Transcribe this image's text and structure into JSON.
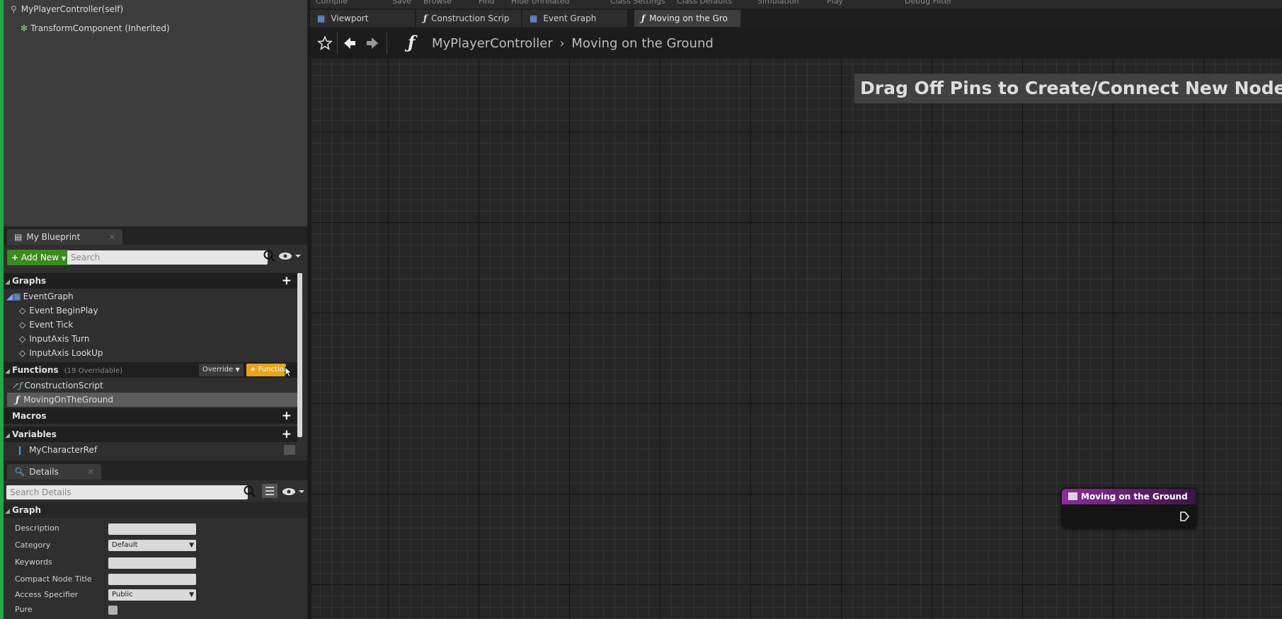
{
  "components": {
    "self_label": "MyPlayerController(self)",
    "child_label": "TransformComponent (Inherited)"
  },
  "my_blueprint": {
    "tab_label": "My Blueprint",
    "add_new_label": "Add New",
    "search_placeholder": "Search",
    "graphs": {
      "header": "Graphs",
      "event_graph": "EventGraph",
      "events": [
        "Event BeginPlay",
        "Event Tick",
        "InputAxis Turn",
        "InputAxis LookUp"
      ]
    },
    "functions": {
      "header": "Functions",
      "overridable": "(19 Overridable)",
      "override_label": "Override",
      "add_function_label": "Function",
      "items": [
        "ConstructionScript",
        "MovingOnTheGround"
      ]
    },
    "macros": {
      "header": "Macros"
    },
    "variables": {
      "header": "Variables",
      "items": [
        "MyCharacterRef"
      ]
    }
  },
  "details": {
    "tab_label": "Details",
    "search_placeholder": "Search Details",
    "section": "Graph",
    "props": {
      "description": "Description",
      "category": "Category",
      "category_value": "Default",
      "keywords": "Keywords",
      "compact_title": "Compact Node Title",
      "access": "Access Specifier",
      "access_value": "Public",
      "pure": "Pure"
    }
  },
  "toolbar": [
    "Compile",
    "Save",
    "Browse",
    "Find",
    "Hide Unrelated",
    "Class Settings",
    "Class Defaults",
    "Simulation",
    "Play",
    "Debug Filter"
  ],
  "doc_tabs": [
    "Viewport",
    "Construction Scrip",
    "Event Graph",
    "Moving on the Gro"
  ],
  "breadcrumb": {
    "root": "MyPlayerController",
    "current": "Moving on the Ground"
  },
  "graph": {
    "hint": "Drag Off Pins to Create/Connect New Nodes.",
    "node_title": "Moving on the Ground",
    "node_color": "#8b2d9c"
  }
}
